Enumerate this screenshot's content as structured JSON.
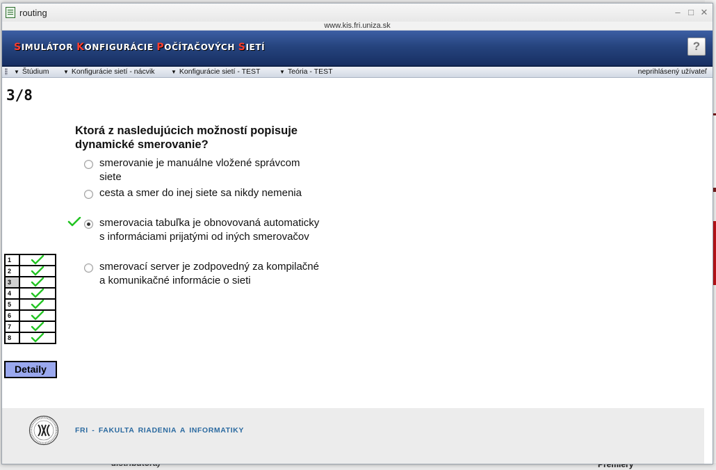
{
  "window": {
    "title": "routing",
    "url": "www.kis.fri.uniza.sk",
    "controls": {
      "minimize": "–",
      "maximize": "□",
      "close": "✕"
    }
  },
  "banner": {
    "title_words": [
      {
        "first": "S",
        "rest": "imulátor"
      },
      {
        "first": "K",
        "rest": "onfigurácie"
      },
      {
        "first": "P",
        "rest": "očítačových"
      },
      {
        "first": "S",
        "rest": "ietí"
      }
    ],
    "help_label": "?"
  },
  "menu": {
    "items": [
      {
        "label": "Štúdium",
        "icon": "triangle-down"
      },
      {
        "label": "Konfigurácie sietí - nácvik",
        "icon": "triangle-down"
      },
      {
        "label": "Konfigurácie sietí - TEST",
        "icon": "triangle-down"
      },
      {
        "label": "Teória - TEST",
        "icon": "triangle-down"
      }
    ],
    "user_status": "neprihlásený užívateľ"
  },
  "quiz": {
    "counter": "3/8",
    "question": "Ktorá z nasledujúcich možností popisuje dynamické smerovanie?",
    "options": [
      {
        "text": "smerovanie je manuálne vložené správcom siete",
        "selected": false,
        "correct": false
      },
      {
        "text": "cesta a smer do inej siete sa nikdy nemenia",
        "selected": false,
        "correct": false
      },
      {
        "text": "smerovacia tabuľka je obnovovaná automaticky s informáciami prijatými od iných smerovačov",
        "selected": true,
        "correct": true
      },
      {
        "text": "smerovací server je zodpovedný za kompilačné a komunikačné informácie o sieti",
        "selected": false,
        "correct": false
      }
    ],
    "nav": [
      {
        "num": "1",
        "status": "correct"
      },
      {
        "num": "2",
        "status": "correct"
      },
      {
        "num": "3",
        "status": "correct",
        "current": true
      },
      {
        "num": "4",
        "status": "correct"
      },
      {
        "num": "5",
        "status": "correct"
      },
      {
        "num": "6",
        "status": "correct"
      },
      {
        "num": "7",
        "status": "correct"
      },
      {
        "num": "8",
        "status": "correct"
      }
    ],
    "details_label": "Detaily"
  },
  "footer": {
    "text": "FRI - FAKULTA RIADENIA A INFORMATIKY",
    "logo_icon": "fri-seal-icon"
  },
  "background_page": {
    "text_left": "distributora)",
    "text_right": "Premiéry"
  },
  "colors": {
    "banner_top": "#3d5fa4",
    "banner_bottom": "#172f63",
    "title_initial": "#ff3d2e",
    "check_green": "#22c422",
    "details_bg": "#9aa8ee",
    "footer_text": "#2b6aa0"
  }
}
